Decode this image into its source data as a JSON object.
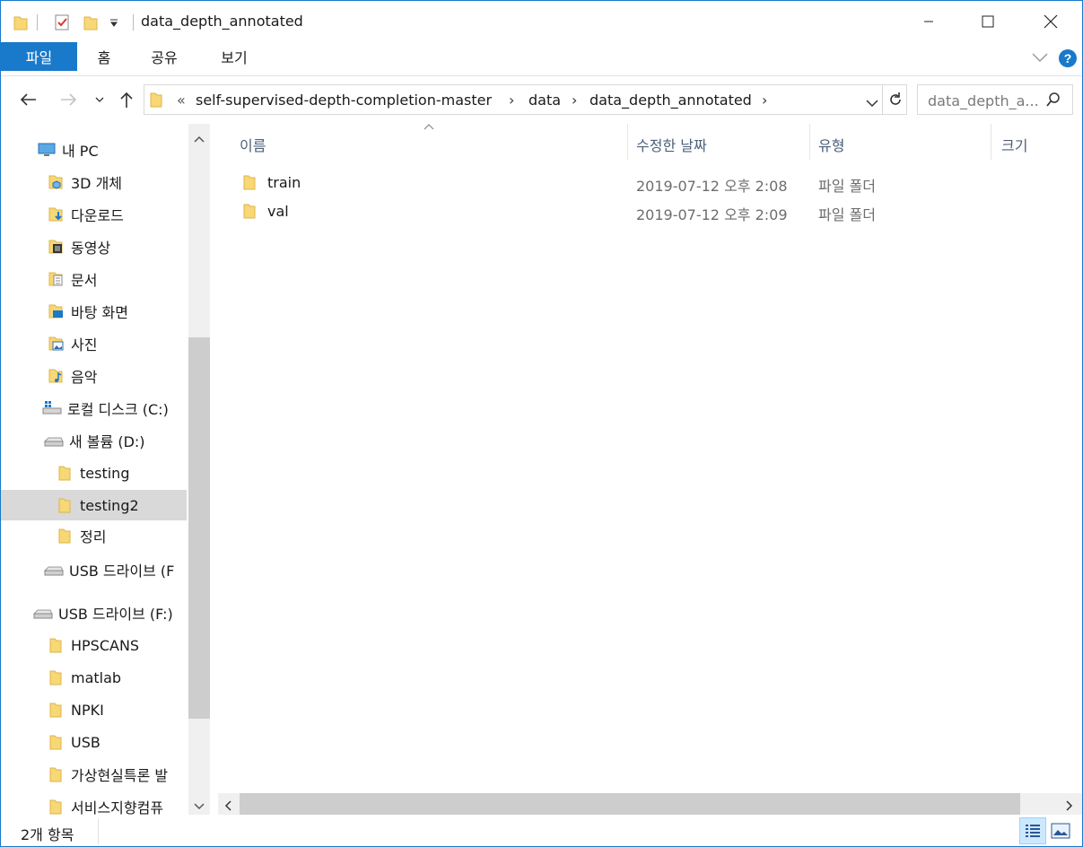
{
  "title": "data_depth_annotated",
  "ribbon": {
    "tabs": [
      "파일",
      "홈",
      "공유",
      "보기"
    ]
  },
  "address": {
    "overflow": "«",
    "crumbs": [
      "self-supervised-depth-completion-master",
      "data",
      "data_depth_annotated"
    ]
  },
  "search": {
    "placeholder": "data_depth_a..."
  },
  "nav": {
    "items": [
      {
        "label": "내 PC",
        "icon": "pc-icon"
      },
      {
        "label": "3D 개체",
        "icon": "3d-objects-icon"
      },
      {
        "label": "다운로드",
        "icon": "downloads-icon"
      },
      {
        "label": "동영상",
        "icon": "videos-icon"
      },
      {
        "label": "문서",
        "icon": "documents-icon"
      },
      {
        "label": "바탕 화면",
        "icon": "desktop-icon"
      },
      {
        "label": "사진",
        "icon": "pictures-icon"
      },
      {
        "label": "음악",
        "icon": "music-icon"
      },
      {
        "label": "로컬 디스크 (C:)",
        "icon": "windows-drive-icon"
      },
      {
        "label": "새 볼륨 (D:)",
        "icon": "drive-icon"
      },
      {
        "label": "testing",
        "icon": "folder-icon"
      },
      {
        "label": "testing2",
        "icon": "folder-icon"
      },
      {
        "label": "정리",
        "icon": "folder-icon"
      },
      {
        "label": "USB 드라이브 (F",
        "icon": "usb-drive-icon"
      },
      {
        "label": "USB 드라이브 (F:)",
        "icon": "usb-drive-icon"
      },
      {
        "label": "HPSCANS",
        "icon": "folder-icon"
      },
      {
        "label": "matlab",
        "icon": "folder-icon"
      },
      {
        "label": "NPKI",
        "icon": "folder-icon"
      },
      {
        "label": "USB",
        "icon": "folder-icon"
      },
      {
        "label": "가상현실특론 발",
        "icon": "folder-icon"
      },
      {
        "label": "서비스지향컴퓨",
        "icon": "folder-icon"
      }
    ]
  },
  "columns": {
    "name": "이름",
    "date": "수정한 날짜",
    "type": "유형",
    "size": "크기"
  },
  "files": [
    {
      "name": "train",
      "date": "2019-07-12 오후 2:08",
      "type": "파일 폴더"
    },
    {
      "name": "val",
      "date": "2019-07-12 오후 2:09",
      "type": "파일 폴더"
    }
  ],
  "status": {
    "count": "2개 항목"
  },
  "colors": {
    "accent": "#1979ca",
    "folder": "#f8d775",
    "selected": "#d9d9d9",
    "header_text": "#4c607a",
    "muted_text": "#6d6d6d"
  }
}
